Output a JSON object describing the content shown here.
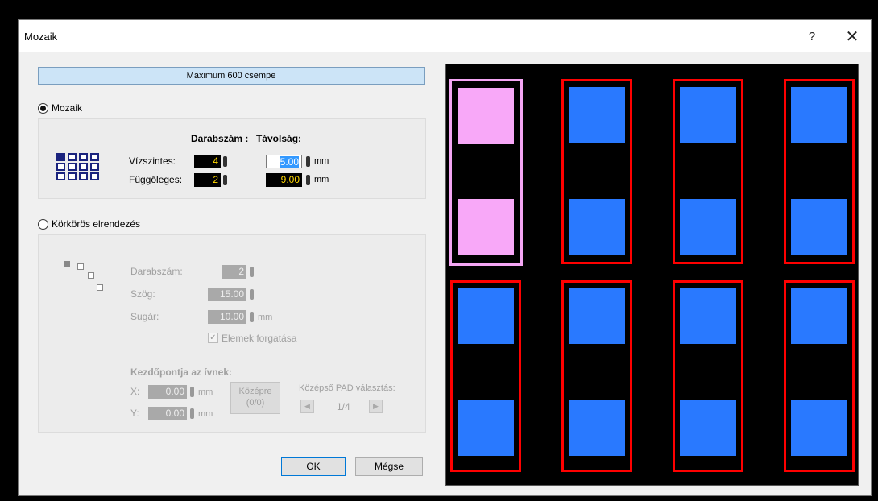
{
  "window": {
    "title": "Mozaik",
    "help_label": "?",
    "close_label": "✕"
  },
  "banner": {
    "text": "Maximum 600 csempe"
  },
  "mosaic": {
    "radio_label": "Mozaik",
    "count_header": "Darabszám :",
    "distance_header": "Távolság:",
    "horizontal_label": "Vízszintes:",
    "vertical_label": "Függőleges:",
    "horizontal_count": "4",
    "vertical_count": "2",
    "horizontal_distance_sel": "5.00",
    "vertical_distance": "9.00",
    "unit": "mm"
  },
  "circular": {
    "radio_label": "Körkörös elrendezés",
    "count_label": "Darabszám:",
    "count_value": "2",
    "angle_label": "Szög:",
    "angle_value": "15.00",
    "radius_label": "Sugár:",
    "radius_value": "10.00",
    "unit": "mm",
    "rotate_check": "✓",
    "rotate_label": "Elemek forgatása",
    "arc_start_header": "Kezdőpontja az ívnek:",
    "x_label": "X:",
    "x_value": "0.00",
    "y_label": "Y:",
    "y_value": "0.00",
    "center_button_line1": "Középre",
    "center_button_line2": "(0/0)",
    "center_pad_label": "Középső PAD választás:",
    "prev_label": "◀",
    "pad_index": "1/4",
    "next_label": "▶"
  },
  "buttons": {
    "ok": "OK",
    "cancel": "Mégse"
  },
  "colors": {
    "pad": "#2979ff",
    "frame": "#ff0000",
    "selected": "#f8a8f8",
    "preview_bg": "#000000"
  },
  "preview": {
    "columns": 4,
    "rows": 2,
    "pads_per_tile": 2,
    "selected_tile": 1
  }
}
